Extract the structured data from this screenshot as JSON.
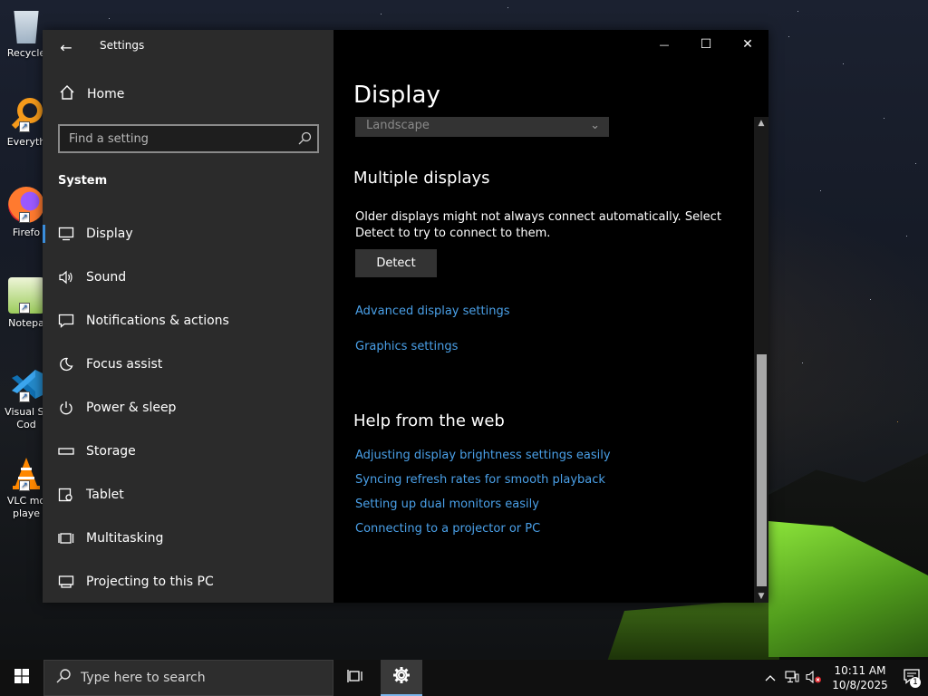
{
  "desktop": {
    "icons": [
      {
        "label": "Recycle"
      },
      {
        "label": "Everyth"
      },
      {
        "label": "Firefo"
      },
      {
        "label": "Notepa"
      },
      {
        "label": "Visual St Cod"
      },
      {
        "label": "VLC mo playe"
      }
    ]
  },
  "window": {
    "app_title": "Settings",
    "back_label": "←",
    "controls": {
      "minimize": "—",
      "maximize": "☐",
      "close": "✕"
    }
  },
  "sidebar": {
    "home_label": "Home",
    "search_placeholder": "Find a setting",
    "section_label": "System",
    "items": [
      {
        "label": "Display",
        "icon": "monitor-icon",
        "active": true
      },
      {
        "label": "Sound",
        "icon": "speaker-icon"
      },
      {
        "label": "Notifications & actions",
        "icon": "notification-icon"
      },
      {
        "label": "Focus assist",
        "icon": "moon-icon"
      },
      {
        "label": "Power & sleep",
        "icon": "power-icon"
      },
      {
        "label": "Storage",
        "icon": "storage-icon"
      },
      {
        "label": "Tablet",
        "icon": "tablet-icon"
      },
      {
        "label": "Multitasking",
        "icon": "multitasking-icon"
      },
      {
        "label": "Projecting to this PC",
        "icon": "projector-icon"
      }
    ]
  },
  "content": {
    "title": "Display",
    "orientation_value": "Landscape",
    "multiple_displays": {
      "heading": "Multiple displays",
      "description": "Older displays might not always connect automatically. Select Detect to try to connect to them.",
      "detect_label": "Detect",
      "links": [
        "Advanced display settings",
        "Graphics settings"
      ]
    },
    "help": {
      "heading": "Help from the web",
      "links": [
        "Adjusting display brightness settings easily",
        "Syncing refresh rates for smooth playback",
        "Setting up dual monitors easily",
        "Connecting to a projector or PC"
      ]
    }
  },
  "taskbar": {
    "search_placeholder": "Type here to search",
    "time": "10:11 AM",
    "date": "10/8/2025",
    "notification_count": "1"
  },
  "colors": {
    "accent_link": "#4aa0e8",
    "sidebar_bg": "#2b2b2b",
    "content_bg": "#000000",
    "taskbar_bg": "#101010"
  }
}
